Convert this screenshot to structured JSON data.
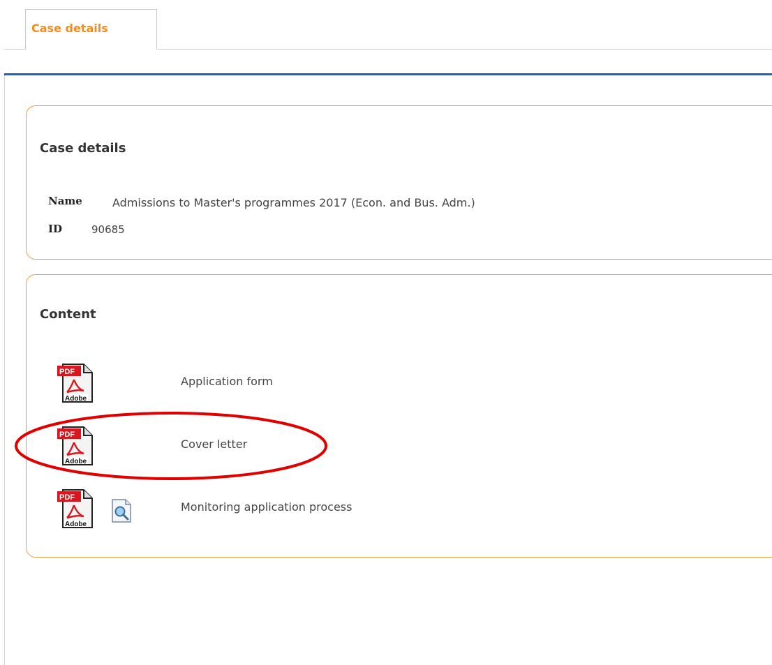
{
  "tabs": [
    {
      "label": "Case details",
      "active": true
    }
  ],
  "case_panel": {
    "title": "Case details",
    "fields": {
      "name": {
        "key": "Name",
        "value": "Admissions to Master's programmes 2017 (Econ. and Bus. Adm.)"
      },
      "id": {
        "key": "ID",
        "value": "90685"
      }
    }
  },
  "content_panel": {
    "title": "Content",
    "documents": [
      {
        "label": "Application form",
        "icon": "pdf-icon",
        "has_preview": false
      },
      {
        "label": "Cover letter",
        "icon": "pdf-icon",
        "has_preview": false,
        "highlighted": true
      },
      {
        "label": "Monitoring application process",
        "icon": "pdf-icon",
        "has_preview": true
      }
    ]
  },
  "pdf_icon": {
    "badge": "PDF",
    "brand": "Adobe"
  },
  "colors": {
    "accent_orange": "#f58a1f",
    "panel_border": "#f39a3c",
    "header_rule_blue": "#1f5fb8",
    "annotation_red": "#e00000"
  }
}
